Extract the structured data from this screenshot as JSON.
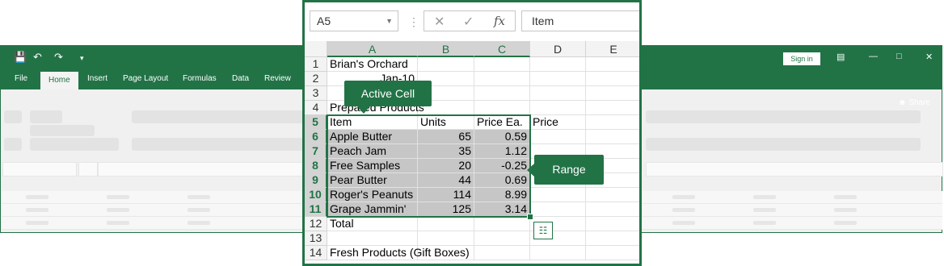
{
  "window": {
    "title_actions": {
      "sign_in": "Sign in",
      "share": "Share"
    },
    "tabs": [
      "File",
      "Home",
      "Insert",
      "Page Layout",
      "Formulas",
      "Data",
      "Review"
    ],
    "active_tab": "Home",
    "accent_color": "#217346"
  },
  "formula_bar": {
    "name_box": "A5",
    "formula": "Item",
    "fx_label": "fx"
  },
  "columns": [
    "A",
    "B",
    "C",
    "D",
    "E"
  ],
  "rows": [
    {
      "num": "1",
      "cells": [
        "Brian's Orchard",
        "",
        "",
        "",
        ""
      ]
    },
    {
      "num": "2",
      "cells": [
        "Jan-10",
        "",
        "",
        "",
        ""
      ]
    },
    {
      "num": "3",
      "cells": [
        "",
        "",
        "",
        "",
        ""
      ]
    },
    {
      "num": "4",
      "cells": [
        "Prepared Products",
        "",
        "",
        "",
        ""
      ]
    },
    {
      "num": "5",
      "cells": [
        "Item",
        "Units",
        "Price Ea.",
        "Price",
        ""
      ]
    },
    {
      "num": "6",
      "cells": [
        "Apple Butter",
        "65",
        "0.59",
        "",
        ""
      ]
    },
    {
      "num": "7",
      "cells": [
        "Peach Jam",
        "35",
        "1.12",
        "",
        ""
      ]
    },
    {
      "num": "8",
      "cells": [
        "Free Samples",
        "20",
        "-0.25",
        "",
        ""
      ]
    },
    {
      "num": "9",
      "cells": [
        "Pear Butter",
        "44",
        "0.69",
        "",
        ""
      ]
    },
    {
      "num": "10",
      "cells": [
        "Roger's Peanuts",
        "114",
        "8.99",
        "",
        ""
      ]
    },
    {
      "num": "11",
      "cells": [
        "Grape Jammin'",
        "125",
        "3.14",
        "",
        ""
      ]
    },
    {
      "num": "12",
      "cells": [
        "Total",
        "",
        "",
        "",
        ""
      ]
    },
    {
      "num": "13",
      "cells": [
        "",
        "",
        "",
        "",
        ""
      ]
    },
    {
      "num": "14",
      "cells": [
        "Fresh Products (Gift Boxes)",
        "",
        "",
        "",
        ""
      ]
    }
  ],
  "callouts": {
    "active_cell": "Active Cell",
    "range": "Range"
  },
  "icons": {
    "save": "save-icon",
    "undo": "undo-icon",
    "redo": "redo-icon",
    "cancel": "cancel-icon",
    "enter": "check-icon",
    "quick_analysis": "quick-analysis-icon"
  }
}
